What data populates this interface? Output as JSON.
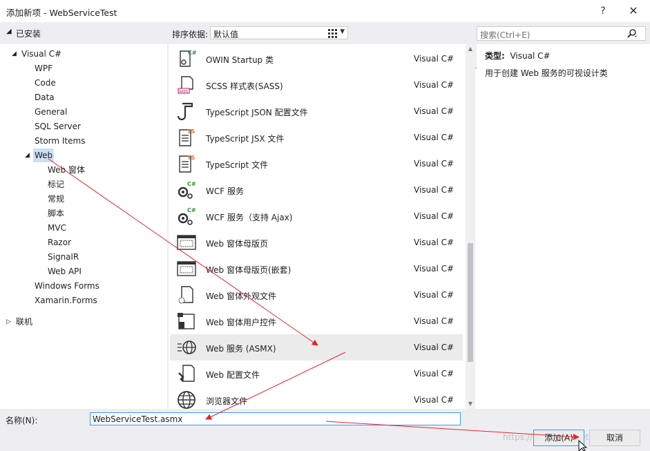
{
  "window": {
    "title": "添加新项 - WebServiceTest",
    "help": "?",
    "close": "✕"
  },
  "left": {
    "installed": "已安装",
    "online": "联机",
    "tree": {
      "root": "Visual C#",
      "items": [
        "WPF",
        "Code",
        "Data",
        "General",
        "SQL Server",
        "Storm Items",
        "Web"
      ],
      "web_children": [
        "Web 窗体",
        "标记",
        "常规",
        "脚本",
        "MVC",
        "Razor",
        "SignalR",
        "Web API"
      ],
      "after": [
        "Windows Forms",
        "Xamarin.Forms"
      ]
    }
  },
  "toolbar": {
    "sort_label": "排序依据:",
    "sort_value": "默认值"
  },
  "search": {
    "placeholder": "搜索(Ctrl+E)"
  },
  "templates": [
    {
      "name": "OWIN Startup 类",
      "lang": "Visual C#",
      "icon": "csharp-class-icon"
    },
    {
      "name": "SCSS 样式表(SASS)",
      "lang": "Visual C#",
      "icon": "scss-file-icon"
    },
    {
      "name": "TypeScript JSON 配置文件",
      "lang": "Visual C#",
      "icon": "json-config-icon"
    },
    {
      "name": "TypeScript JSX 文件",
      "lang": "Visual C#",
      "icon": "ts-file-icon"
    },
    {
      "name": "TypeScript 文件",
      "lang": "Visual C#",
      "icon": "ts-file-icon"
    },
    {
      "name": "WCF 服务",
      "lang": "Visual C#",
      "icon": "wcf-service-icon"
    },
    {
      "name": "WCF 服务（支持 Ajax)",
      "lang": "Visual C#",
      "icon": "wcf-service-icon"
    },
    {
      "name": "Web 窗体母版页",
      "lang": "Visual C#",
      "icon": "master-page-icon"
    },
    {
      "name": "Web 窗体母版页(嵌套)",
      "lang": "Visual C#",
      "icon": "master-page-icon"
    },
    {
      "name": "Web 窗体外观文件",
      "lang": "Visual C#",
      "icon": "skin-file-icon"
    },
    {
      "name": "Web 窗体用户控件",
      "lang": "Visual C#",
      "icon": "user-control-icon"
    },
    {
      "name": "Web 服务 (ASMX)",
      "lang": "Visual C#",
      "icon": "web-service-globe-icon"
    },
    {
      "name": "Web 配置文件",
      "lang": "Visual C#",
      "icon": "config-file-icon"
    },
    {
      "name": "浏览器文件",
      "lang": "Visual C#",
      "icon": "browser-globe-icon"
    }
  ],
  "selected_index": 11,
  "details": {
    "type_label": "类型:",
    "type_value": "Visual C#",
    "description": "用于创建 Web 服务的可视设计类"
  },
  "bottom": {
    "name_label": "名称(N):",
    "name_value": "WebServiceTest.asmx",
    "add_button": "添加(A)",
    "cancel_button": "取消",
    "watermark": "https://blog.csdn.net/lyhyc"
  },
  "colors": {
    "accent": "#3399ff",
    "selection": "#cce0f4",
    "annotation": "#e8232a"
  }
}
